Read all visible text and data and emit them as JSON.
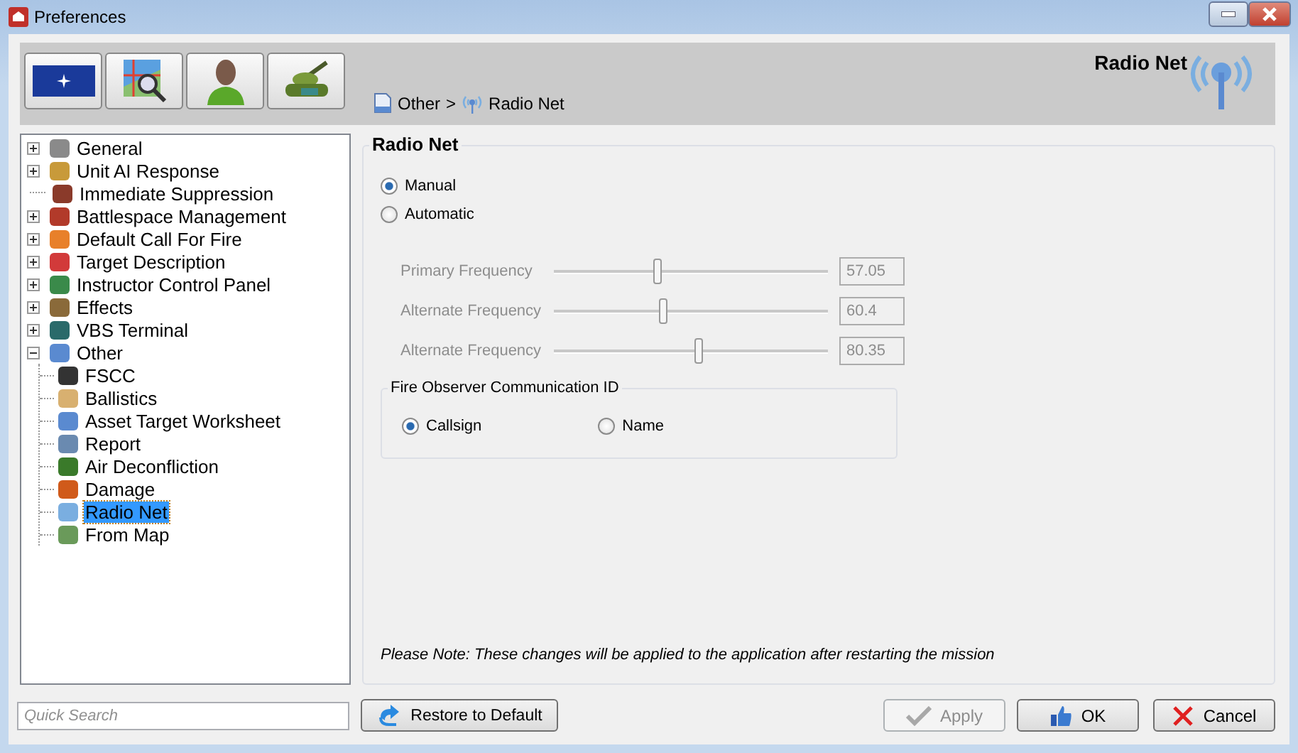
{
  "window": {
    "title": "Preferences"
  },
  "toolbar": [
    {
      "kind": "flag"
    },
    {
      "kind": "map"
    },
    {
      "kind": "person"
    },
    {
      "kind": "tank"
    }
  ],
  "header": {
    "title": "Radio Net",
    "breadcrumb": [
      "Other",
      ">",
      "Radio Net"
    ]
  },
  "tree": [
    {
      "label": "General",
      "expanded": false,
      "selected": false,
      "color": "#8a8a8a"
    },
    {
      "label": "Unit AI Response",
      "expanded": false,
      "selected": false,
      "color": "#c89a3a"
    },
    {
      "label": "Immediate Suppression",
      "selected": false,
      "color": "#8a3a2a"
    },
    {
      "label": "Battlespace Management",
      "expanded": false,
      "selected": false,
      "color": "#b23a2a"
    },
    {
      "label": "Default Call For Fire",
      "expanded": false,
      "selected": false,
      "color": "#e8802a"
    },
    {
      "label": "Target Description",
      "expanded": false,
      "selected": false,
      "color": "#d23a3a"
    },
    {
      "label": "Instructor Control Panel",
      "expanded": false,
      "selected": false,
      "color": "#3a8a4a"
    },
    {
      "label": "Effects",
      "expanded": false,
      "selected": false,
      "color": "#8a6a3a"
    },
    {
      "label": "VBS Terminal",
      "expanded": false,
      "selected": false,
      "color": "#2a6a6a"
    },
    {
      "label": "Other",
      "expanded": true,
      "selected": false,
      "color": "#5a8ad0",
      "children": [
        {
          "label": "FSCC",
          "selected": false,
          "color": "#333333"
        },
        {
          "label": "Ballistics",
          "selected": false,
          "color": "#d8b070"
        },
        {
          "label": "Asset Target Worksheet",
          "selected": false,
          "color": "#5a8ad0"
        },
        {
          "label": "Report",
          "selected": false,
          "color": "#6a8ab0"
        },
        {
          "label": "Air Deconfliction",
          "selected": false,
          "color": "#3a7a2a"
        },
        {
          "label": "Damage",
          "selected": false,
          "color": "#d05a1a"
        },
        {
          "label": "Radio Net",
          "selected": true,
          "color": "#7aaee0"
        },
        {
          "label": "From Map",
          "selected": false,
          "color": "#6a9a5a"
        }
      ]
    }
  ],
  "panel": {
    "title": "Radio Net",
    "modes": [
      {
        "label": "Manual",
        "selected": true
      },
      {
        "label": "Automatic",
        "selected": false
      }
    ],
    "frequencies": [
      {
        "label": "Primary Frequency",
        "level": 0.38,
        "value": "57.05",
        "disabled": true
      },
      {
        "label": "Alternate Frequency",
        "level": 0.4,
        "value": "60.4",
        "disabled": true
      },
      {
        "label": "Alternate Frequency",
        "level": 0.53,
        "value": "80.35",
        "disabled": true
      }
    ],
    "id_group": {
      "title": "Fire Observer Communication ID",
      "options": [
        {
          "label": "Callsign",
          "selected": true
        },
        {
          "label": "Name",
          "selected": false
        }
      ]
    },
    "note": "Please Note: These changes will be applied to the application after restarting the mission"
  },
  "search": {
    "placeholder": "Quick Search"
  },
  "buttons": [
    {
      "label": "Restore to Default",
      "kind": "restore",
      "disabled": false
    },
    {
      "label": "Apply",
      "kind": "apply",
      "disabled": true
    },
    {
      "label": "OK",
      "kind": "ok",
      "disabled": false
    },
    {
      "label": "Cancel",
      "kind": "cancel",
      "disabled": false
    }
  ]
}
